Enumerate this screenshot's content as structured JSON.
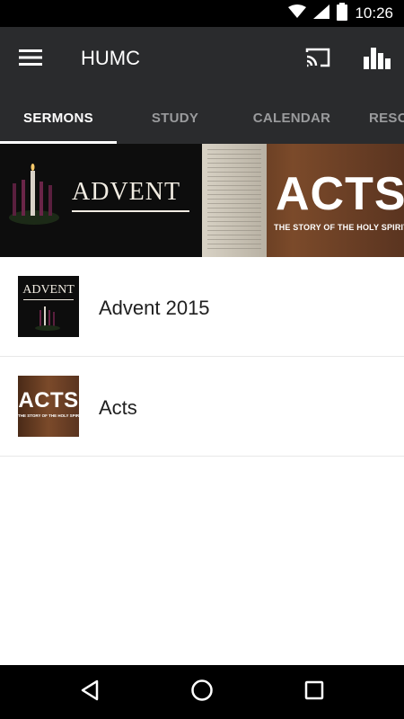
{
  "status_bar": {
    "time": "10:26",
    "icons": [
      "wifi-icon",
      "signal-icon",
      "battery-icon"
    ]
  },
  "app_bar": {
    "title": "HUMC",
    "icons": [
      "menu-icon",
      "cast-icon",
      "bar-chart-icon"
    ]
  },
  "tabs": [
    {
      "label": "SERMONS",
      "active": true
    },
    {
      "label": "STUDY",
      "active": false
    },
    {
      "label": "CALENDAR",
      "active": false
    },
    {
      "label": "RESO",
      "active": false
    }
  ],
  "banner": {
    "advent_text": "ADVENT",
    "acts_text": "ACTS",
    "acts_subtitle": "THE STORY OF THE HOLY SPIRIT"
  },
  "sermon_series": [
    {
      "title": "Advent 2015",
      "thumb_text": "ADVENT"
    },
    {
      "title": "Acts",
      "thumb_text": "ACTS",
      "thumb_subtext": "THE STORY OF THE HOLY SPIRIT"
    }
  ],
  "nav_bar": {
    "icons": [
      "back-icon",
      "home-icon",
      "recents-icon"
    ]
  },
  "colors": {
    "app_bar": "#2a2b2d",
    "tab_inactive": "#9a9b9d",
    "tab_active": "#ffffff"
  }
}
